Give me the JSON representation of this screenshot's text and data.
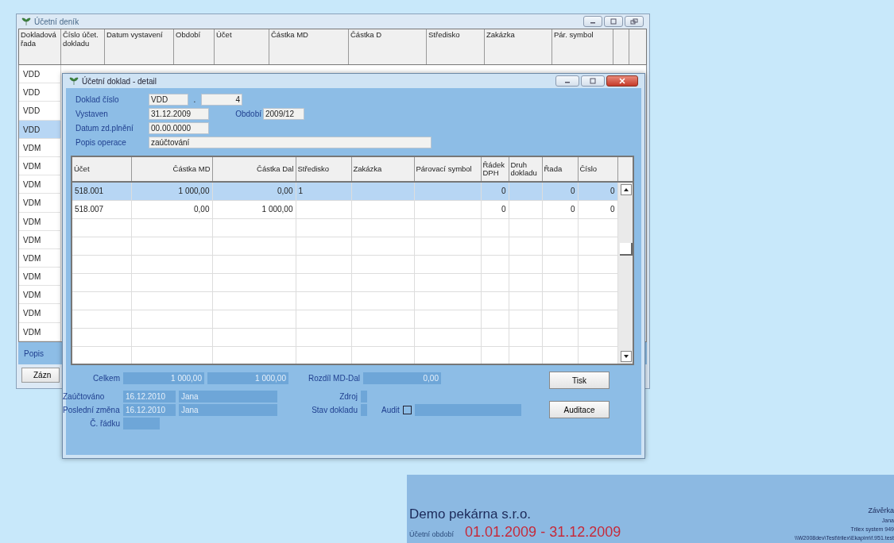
{
  "journal_window": {
    "title": "Účetní deník",
    "columns": [
      "Dokladová řada",
      "Číslo účet. dokladu",
      "Datum vystavení",
      "Období",
      "Účet",
      "Částka MD",
      "Částka D",
      "Středisko",
      "Zakázka",
      "Pár. symbol"
    ],
    "rows": [
      {
        "series": "VDD",
        "selected": false
      },
      {
        "series": "VDD",
        "selected": false
      },
      {
        "series": "VDD",
        "selected": false
      },
      {
        "series": "VDD",
        "selected": true
      },
      {
        "series": "VDM",
        "selected": false
      },
      {
        "series": "VDM",
        "selected": false
      },
      {
        "series": "VDM",
        "selected": false
      },
      {
        "series": "VDM",
        "selected": false
      },
      {
        "series": "VDM",
        "selected": false
      },
      {
        "series": "VDM",
        "selected": false
      },
      {
        "series": "VDM",
        "selected": false
      },
      {
        "series": "VDM",
        "selected": false
      },
      {
        "series": "VDM",
        "selected": false
      },
      {
        "series": "VDM",
        "selected": false
      },
      {
        "series": "VDM",
        "selected": false
      }
    ],
    "description_label": "Popis",
    "record_button": "Zázn"
  },
  "detail_window": {
    "title": "Účetní doklad - detail",
    "document_number": {
      "label": "Doklad číslo",
      "series": "VDD",
      "separator": ".",
      "number": "4"
    },
    "issued": {
      "label": "Vystaven",
      "value": "31.12.2009"
    },
    "period": {
      "label": "Období",
      "value": "2009/12"
    },
    "taxable_date": {
      "label": "Datum zd.plnění",
      "value": "00.00.0000"
    },
    "operation": {
      "label": "Popis operace",
      "value": "zaúčtování"
    },
    "grid": {
      "columns": [
        "Účet",
        "Částka MD",
        "Částka Dal",
        "Středisko",
        "Zakázka",
        "Párovací symbol",
        "Řádek DPH",
        "Druh dokladu",
        "Řada",
        "Číslo"
      ],
      "rows": [
        {
          "cells": [
            "518.001",
            "1 000,00",
            "0,00",
            "1",
            null,
            null,
            "0",
            null,
            "0",
            "0"
          ],
          "selected": true
        },
        {
          "cells": [
            "518.007",
            "0,00",
            "1 000,00",
            null,
            null,
            null,
            "0",
            null,
            "0",
            "0"
          ],
          "selected": false
        }
      ]
    },
    "summary": {
      "total_label": "Celkem",
      "total_debit": "1 000,00",
      "total_credit": "1 000,00",
      "difference_label": "Rozdíl MD-Dal",
      "difference": "0,00",
      "posted_label": "Zaúčtováno",
      "posted_date": "16.12.2010",
      "posted_by": "Jana",
      "changed_label": "Poslední změna",
      "changed_date": "16.12.2010",
      "changed_by": "Jana",
      "line_label": "Č. řádku",
      "source_label": "Zdroj",
      "status_label": "Stav dokladu",
      "audit": {
        "label": "Audit",
        "checked": false
      }
    },
    "buttons": [
      "Tisk",
      "Auditace"
    ]
  },
  "footer": {
    "company": "Demo pekárna s.r.o.",
    "period_label": "Účetní období",
    "period": "01.01.2009 - 31.12.2009",
    "info_lines": [
      "Závěrka",
      "Jana",
      "Trilex system 949",
      "\\\\W2008dev\\Test\\trilex\\Ekapim\\f.951.test"
    ]
  }
}
